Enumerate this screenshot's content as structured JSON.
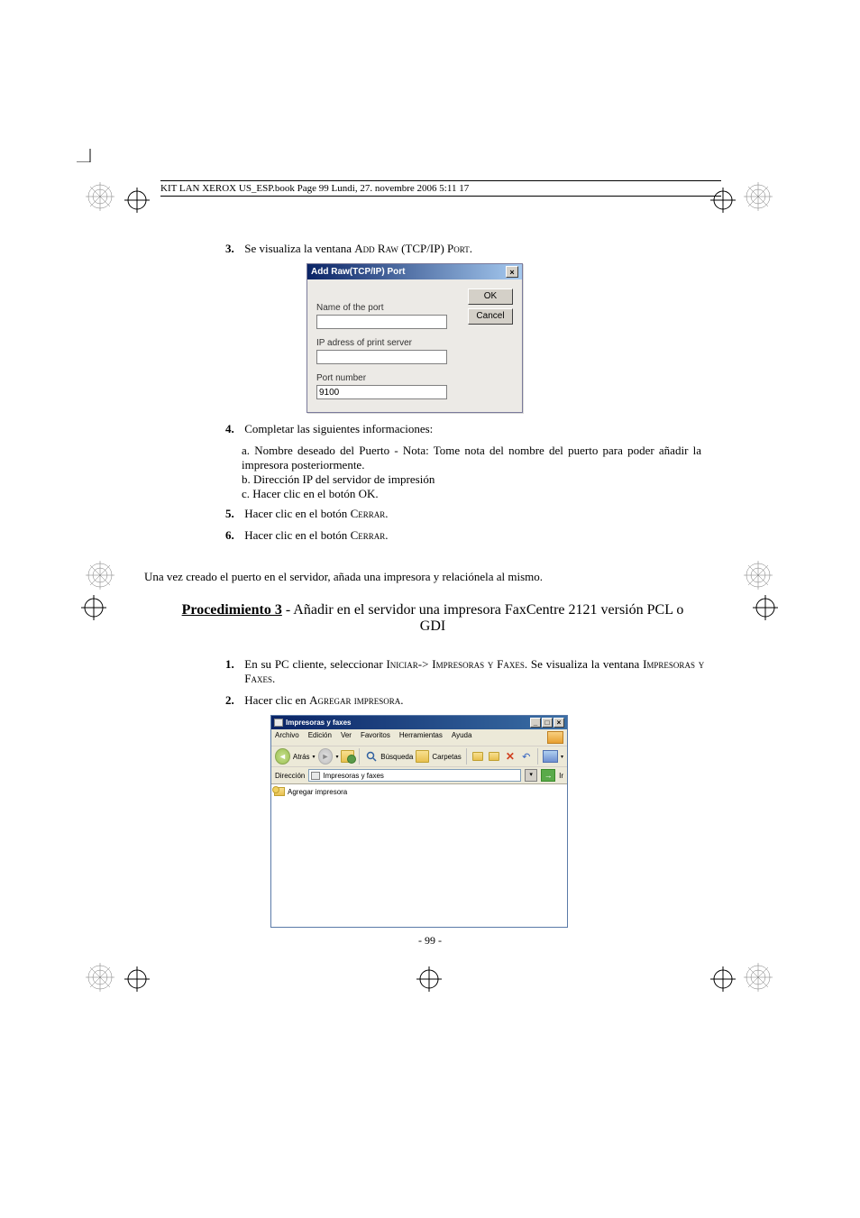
{
  "header_text": "KIT LAN XEROX US_ESP.book  Page 99  Lundi, 27. novembre 2006  5:11 17",
  "step3_num": "3.",
  "step3_text_a": "Se visualiza la ventana ",
  "step3_text_b": "Add Raw (TCP/IP) Port",
  "step3_text_c": ".",
  "dialog": {
    "title": "Add Raw(TCP/IP) Port",
    "label_name": "Name of the port",
    "label_ip": "IP adress of print server",
    "label_portnum": "Port number",
    "value_portnum": "9100",
    "btn_ok": "OK",
    "btn_cancel": "Cancel"
  },
  "step4_num": "4.",
  "step4_text": "Completar las siguientes informaciones:",
  "step4_a": "a. Nombre deseado del Puerto - Nota: Tome nota del nombre del puerto para poder añadir la impresora posteriormente.",
  "step4_b": "b. Dirección IP del servidor de impresión",
  "step4_c": "c. Hacer clic en el botón OK.",
  "step5_num": "5.",
  "step5_text_a": "Hacer clic en el botón ",
  "step5_text_b": "Cerrar",
  "step5_text_c": ".",
  "step6_num": "6.",
  "step6_text_a": "Hacer clic en el botón ",
  "step6_text_b": "Cerrar",
  "step6_text_c": ".",
  "mid_para": "Una vez creado el puerto en el servidor,  añada una impresora y relaciónela al mismo.",
  "proc3_u": "Procedimiento 3",
  "proc3_rest": " - Añadir en el servidor una impresora FaxCentre 2121 versión PCL o GDI",
  "p3s1_num": "1.",
  "p3s1_a": "En su PC cliente, seleccionar ",
  "p3s1_b": "Iniciar",
  "p3s1_c": "-> ",
  "p3s1_d": "Impresoras y Faxes",
  "p3s1_e": ". Se visualiza la ventana ",
  "p3s1_f": "Impresoras y Faxes",
  "p3s1_g": ".",
  "p3s2_num": "2.",
  "p3s2_a": "Hacer clic en ",
  "p3s2_b": "Agregar impresora",
  "p3s2_c": ".",
  "win2": {
    "title": "Impresoras y faxes",
    "menu": [
      "Archivo",
      "Edición",
      "Ver",
      "Favoritos",
      "Herramientas",
      "Ayuda"
    ],
    "tb_atras": "Atrás",
    "tb_busqueda": "Búsqueda",
    "tb_carpetas": "Carpetas",
    "addr_label": "Dirección",
    "addr_value": "Impresoras y faxes",
    "go_label": "Ir",
    "add_printer": "Agregar impresora"
  },
  "page_number": "- 99 -"
}
